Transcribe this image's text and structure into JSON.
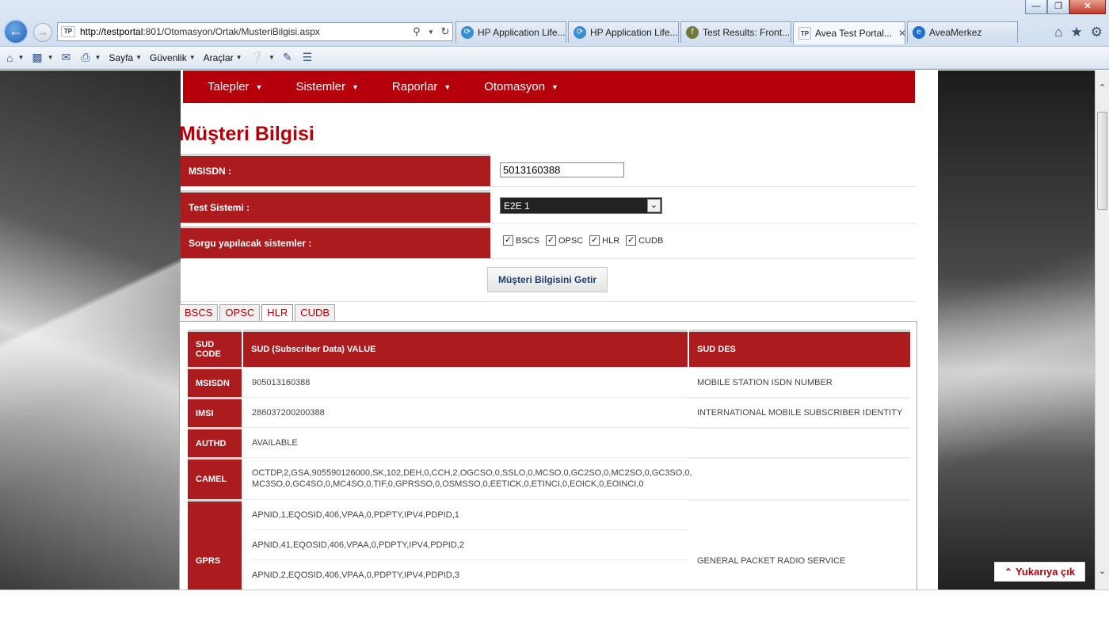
{
  "browser": {
    "address_url_host": "http://testportal",
    "address_url_rest": ":801/Otomasyon/Ortak/MusteriBilgisi.aspx",
    "favicon_text": "TP",
    "tabs": [
      {
        "label": "HP Application Life...",
        "icon": "hp-icon",
        "active": false
      },
      {
        "label": "HP Application Life...",
        "icon": "hp-icon",
        "active": false
      },
      {
        "label": "Test Results: Front...",
        "icon": "fit-icon",
        "active": false
      },
      {
        "label": "Avea Test Portal...",
        "icon": "tp-icon",
        "active": true
      },
      {
        "label": "AveaMerkez",
        "icon": "ie-icon",
        "active": false
      }
    ],
    "command_bar": {
      "page_label": "Sayfa",
      "security_label": "Güvenlik",
      "tools_label": "Araçlar"
    }
  },
  "nav": {
    "items": [
      "Talepler",
      "Sistemler",
      "Raporlar",
      "Otomasyon"
    ]
  },
  "page": {
    "title": "Müşteri Bilgisi",
    "form": {
      "msisdn_label": "MSISDN :",
      "msisdn_value": "5013160388",
      "test_system_label": "Test Sistemi :",
      "test_system_value": "E2E 1",
      "query_systems_label": "Sorgu yapılacak sistemler :",
      "systems": [
        {
          "label": "BSCS",
          "checked": true
        },
        {
          "label": "OPSC",
          "checked": true
        },
        {
          "label": "HLR",
          "checked": true
        },
        {
          "label": "CUDB",
          "checked": true
        }
      ]
    },
    "fetch_button": "Müşteri Bilgisini Getir",
    "result_tabs": [
      "BSCS",
      "OPSC",
      "HLR",
      "CUDB"
    ],
    "active_result_tab": "HLR",
    "table": {
      "headers": {
        "code": "SUD CODE",
        "value": "SUD (Subscriber Data) VALUE",
        "des": "SUD DES"
      },
      "rows": [
        {
          "code": "MSISDN",
          "value": [
            "905013160388"
          ],
          "des": "MOBILE STATION ISDN NUMBER"
        },
        {
          "code": "IMSI",
          "value": [
            "286037200200388"
          ],
          "des": "INTERNATIONAL MOBILE SUBSCRIBER IDENTITY"
        },
        {
          "code": "AUTHD",
          "value": [
            "AVAILABLE"
          ],
          "des": ""
        },
        {
          "code": "CAMEL",
          "value": [
            "OCTDP,2,GSA,905590126000,SK,102,DEH,0,CCH,2,OGCSO,0,SSLO,0,MCSO,0,GC2SO,0,MC2SO,0,GC3SO,0,",
            "MC3SO,0,GC4SO,0,MC4SO,0,TIF,0,GPRSSO,0,OSMSSO,0,EETICK,0,ETINCI,0,EOICK,0,EOINCI,0"
          ],
          "des": ""
        },
        {
          "code": "GPRS",
          "value": [
            "APNID,1,EQOSID,406,VPAA,0,PDPTY,IPV4,PDPID,1",
            "APNID,41,EQOSID,406,VPAA,0,PDPTY,IPV4,PDPID,2",
            "APNID,2,EQOSID,406,VPAA,0,PDPTY,IPV4,PDPID,3"
          ],
          "des": "GENERAL PACKET RADIO SERVICE"
        }
      ]
    },
    "scroll_top_button": "Yukarıya çık"
  },
  "colors": {
    "brand_red": "#b5000b",
    "label_red": "#ac1b1e"
  }
}
